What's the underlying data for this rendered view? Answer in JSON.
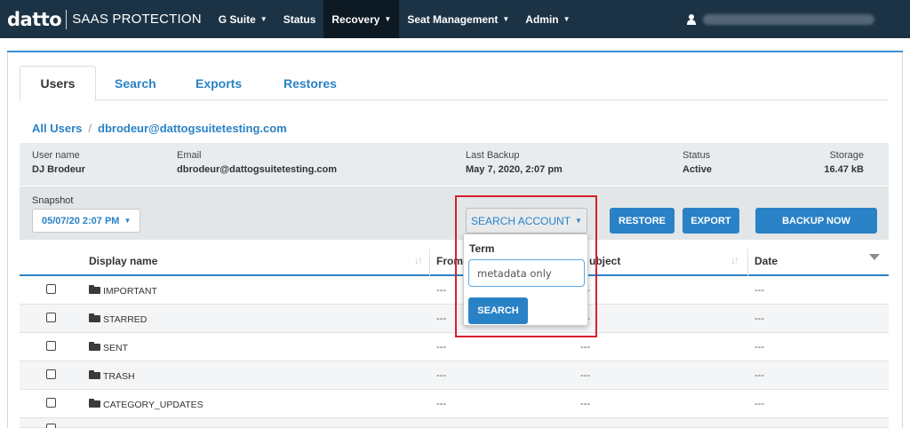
{
  "topnav": {
    "logo_word": "datto",
    "product": "SAAS PROTECTION",
    "items": [
      {
        "label": "G Suite",
        "caret": true,
        "active": false
      },
      {
        "label": "Status",
        "caret": false,
        "active": false
      },
      {
        "label": "Recovery",
        "caret": true,
        "active": true
      },
      {
        "label": "Seat Management",
        "caret": true,
        "active": false
      },
      {
        "label": "Admin",
        "caret": true,
        "active": false
      }
    ]
  },
  "tabs": [
    "Users",
    "Search",
    "Exports",
    "Restores"
  ],
  "breadcrumb": {
    "root": "All Users",
    "current": "dbrodeur@dattogsuitetesting.com"
  },
  "user_info": {
    "username_label": "User name",
    "username": "DJ Brodeur",
    "email_label": "Email",
    "email": "dbrodeur@dattogsuitetesting.com",
    "backup_label": "Last Backup",
    "backup": "May 7, 2020, 2:07 pm",
    "status_label": "Status",
    "status": "Active",
    "storage_label": "Storage",
    "storage": "16.47 kB"
  },
  "snapshot": {
    "label": "Snapshot",
    "value": "05/07/20 2:07 PM"
  },
  "actions": {
    "search_account": "SEARCH ACCOUNT",
    "restore": "RESTORE",
    "export": "EXPORT",
    "backup_now": "BACKUP NOW"
  },
  "table": {
    "columns": {
      "display_name": "Display name",
      "from": "From",
      "subject": "ubject",
      "date": "Date"
    },
    "rows": [
      {
        "name": "IMPORTANT",
        "from": "---",
        "subject": "---",
        "date": "---"
      },
      {
        "name": "STARRED",
        "from": "---",
        "subject": "---",
        "date": "---"
      },
      {
        "name": "SENT",
        "from": "---",
        "subject": "---",
        "date": "---"
      },
      {
        "name": "TRASH",
        "from": "---",
        "subject": "---",
        "date": "---"
      },
      {
        "name": "CATEGORY_UPDATES",
        "from": "---",
        "subject": "---",
        "date": "---"
      }
    ]
  },
  "search_popover": {
    "term_label": "Term",
    "term_value": "metadata only",
    "search_button": "SEARCH"
  },
  "colors": {
    "nav_bg": "#1b3344",
    "accent": "#2a82c6",
    "highlight": "#d4222c"
  }
}
